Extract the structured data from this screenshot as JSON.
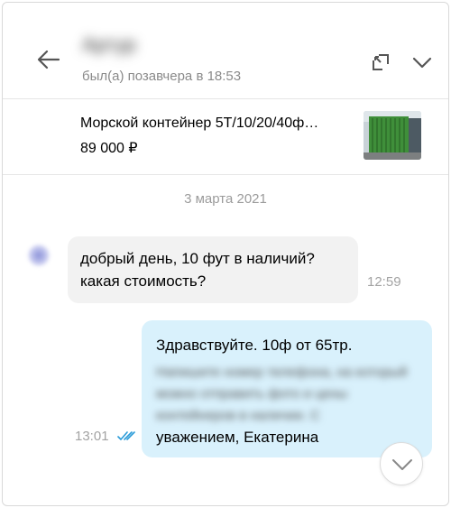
{
  "header": {
    "contact_name": "Артур",
    "last_seen": "был(а) позавчера в 18:53",
    "icons": {
      "back": "arrow-left-icon",
      "expand": "expand-icon",
      "collapse": "chevron-down-icon"
    }
  },
  "listing": {
    "title": "Морской контейнер 5Т/10/20/40ф…",
    "price": "89 000 ₽",
    "thumb_color": "#3f8f3a"
  },
  "date_separator": "3 марта 2021",
  "messages": [
    {
      "direction": "incoming",
      "lines": [
        "добрый день, 10 фут в наличий?",
        "какая стоимость?"
      ],
      "time": "12:59"
    },
    {
      "direction": "outgoing",
      "first_line": "Здравствуйте. 10ф от 65тр.",
      "blurred_text": "Напишите номер телефона, на который можно отправить фото и цены контейнеров в наличии. С",
      "last_line": "уважением, Екатерина",
      "time": "13:01",
      "status_icon": "double-check-icon"
    }
  ],
  "colors": {
    "incoming_bubble": "#f2f2f2",
    "outgoing_bubble": "#d9f1fc",
    "read_check": "#2a9bd8"
  }
}
